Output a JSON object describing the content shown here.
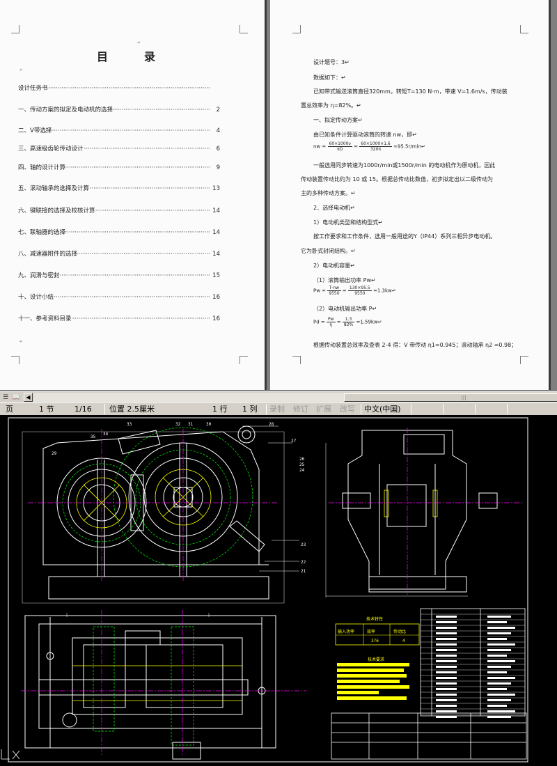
{
  "page1": {
    "toc_title": "目　录",
    "para_mark": "↵",
    "entries": [
      {
        "label": "设计任务书",
        "page": ""
      },
      {
        "label": "一、传动方案的拟定及电动机的选择",
        "page": "2"
      },
      {
        "label": "二、V带选择",
        "page": "4"
      },
      {
        "label": "三、高速级齿轮传动设计",
        "page": "6"
      },
      {
        "label": "四、轴的设计计算",
        "page": "9"
      },
      {
        "label": "五、滚动轴承的选择及计算",
        "page": "13"
      },
      {
        "label": "六、键联接的选择及校核计算",
        "page": "14"
      },
      {
        "label": "七、联轴器的选择",
        "page": "14"
      },
      {
        "label": "八、减速器附件的选择",
        "page": "14"
      },
      {
        "label": "九、润滑与密封",
        "page": "15"
      },
      {
        "label": "十、设计小结",
        "page": "16"
      },
      {
        "label": "十一、参考资料目录",
        "page": "16"
      }
    ]
  },
  "page2": {
    "lines": [
      "设计题号：3↵",
      "数据如下：↵",
      "已知带式输送滚筒直径320mm，转矩T=130 N·m，带速 V=1.6m/s，传动装",
      "置总效率为 η=82%。↵",
      "一、拟定传动方案↵",
      "由已知条件计算驱动滚筒的转速 nw，即↵",
      "一般选用同步转速为1000r/min或1500r/min 的电动机作为原动机，因此",
      "传动装置传动比约为 10 或 15。根据总传动比数值，初步拟定出以二级传动为",
      "主的多种传动方案。↵",
      "2．选择电动机↵",
      "1）电动机类型和结构型式↵",
      "按工作要求和工作条件，选用一般用途的Y（IP44）系列三相异步电动机。",
      "它为卧式封闭结构。↵",
      "2）电动机容量↵",
      "（1）滚筒输出功率 Pw↵",
      "（2）电动机输出功率 P↵",
      "根据传动装置总效率及查表 2-4 得：V 带传动 η1=0.945；滚动轴承 η2 =0.98；"
    ],
    "formula1": {
      "lhs": "nw =",
      "n1": "60×1000υ",
      "d1": "πD",
      "eq": "=",
      "n2": "60×1000×1.6",
      "d2": "320π",
      "rhs": "≈95.5r/min↵"
    },
    "formula2": {
      "lhs": "Pw =",
      "n1": "T·nw",
      "d1": "9550",
      "eq": "=",
      "n2": "130×95.5",
      "d2": "9550",
      "rhs": "=1.3kw↵"
    },
    "formula3": {
      "lhs": "Pd =",
      "n1": "Pw",
      "d1": "η",
      "eq": "=",
      "n2": "1.3",
      "d2": "82%",
      "rhs": "=1.59kw↵"
    }
  },
  "scrollbar": {
    "thumb_grip": "|||"
  },
  "statusbar": {
    "page_label": "页",
    "section": "1 节",
    "page_of": "1/16",
    "position": "位置 2.5厘米",
    "line": "1 行",
    "column": "1 列",
    "rec": "录制",
    "trk": "修订",
    "ext": "扩展",
    "ovr": "改写",
    "language": "中文(中国)"
  },
  "cad": {
    "colors": {
      "background": "#000000",
      "outline": "#ffffff",
      "center": "#ff00ff",
      "hidden": "#00ff00",
      "highlight": "#ffff00"
    },
    "callouts": [
      "33",
      "35",
      "34",
      "32",
      "31",
      "30",
      "29",
      "28",
      "27",
      "26",
      "25",
      "24",
      "23",
      "22",
      "21"
    ],
    "tech_spec_title": "技术特性",
    "tech_req_title": "技术要求",
    "spec_headers": [
      "输入功率",
      "效率",
      "传动比"
    ],
    "spec_values": [
      "376",
      "4"
    ]
  }
}
